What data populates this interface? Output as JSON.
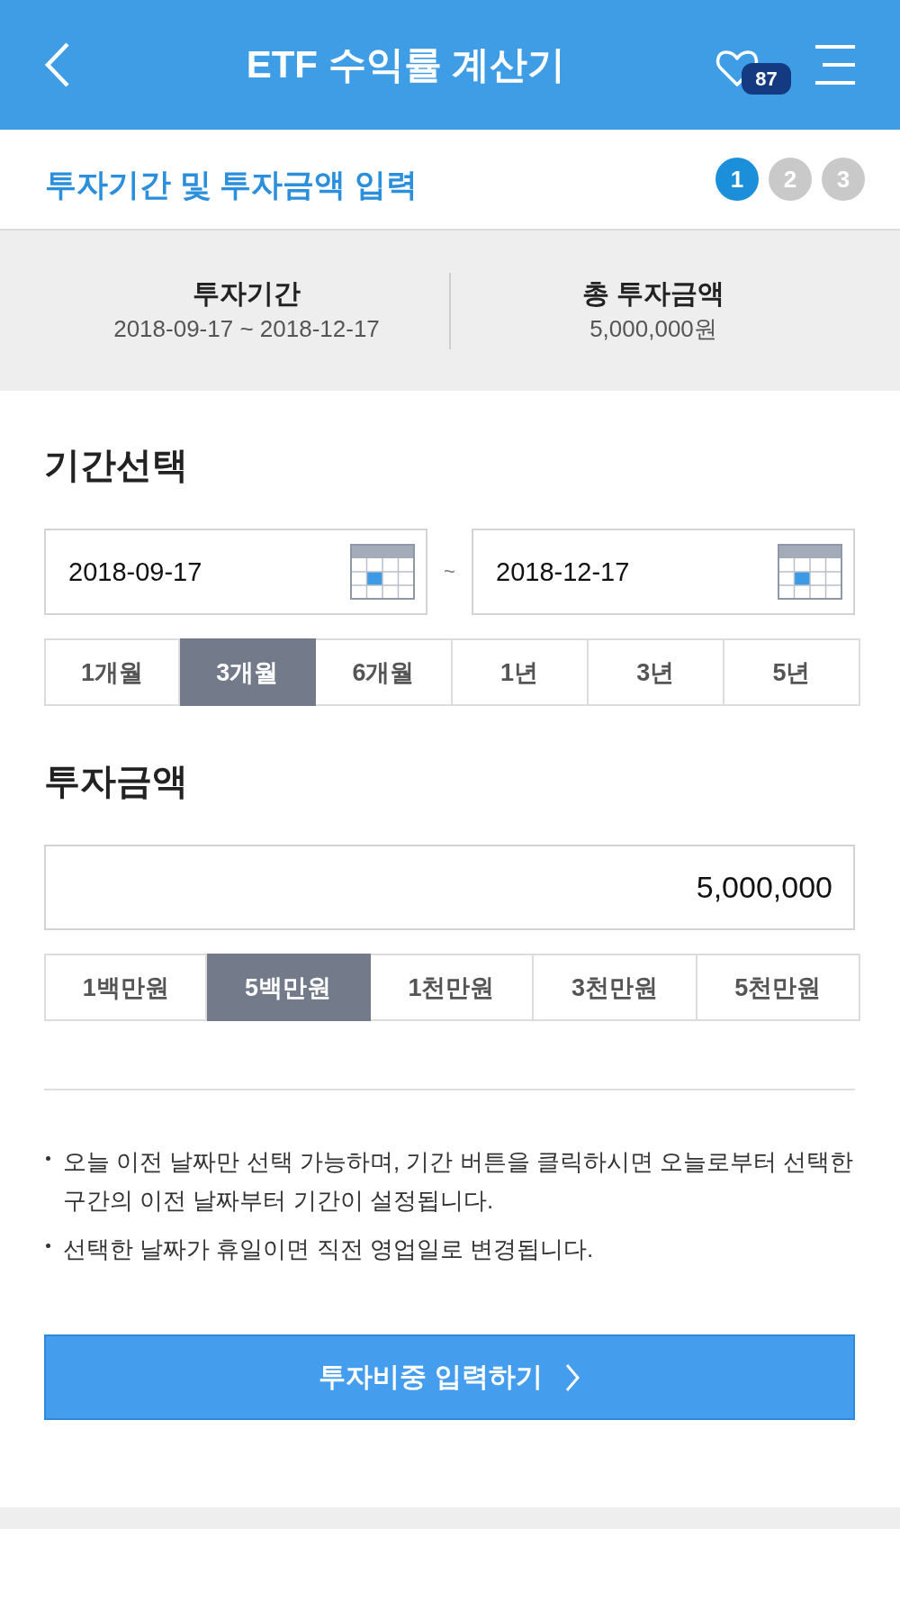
{
  "header": {
    "title": "ETF 수익률 계산기",
    "favorites_count": "87"
  },
  "step": {
    "title": "투자기간 및 투자금액 입력",
    "steps": [
      {
        "label": "1",
        "selected": true
      },
      {
        "label": "2",
        "selected": false
      },
      {
        "label": "3",
        "selected": false
      }
    ]
  },
  "summary": [
    {
      "label": "투자기간",
      "value": "2018-09-17 ~ 2018-12-17"
    },
    {
      "label": "총 투자금액",
      "value": "5,000,000원"
    }
  ],
  "period": {
    "heading": "기간선택",
    "start_date": "2018-09-17",
    "separator": "~",
    "end_date": "2018-12-17",
    "options": [
      {
        "label": "1개월",
        "selected": false
      },
      {
        "label": "3개월",
        "selected": true
      },
      {
        "label": "6개월",
        "selected": false
      },
      {
        "label": "1년",
        "selected": false
      },
      {
        "label": "3년",
        "selected": false
      },
      {
        "label": "5년",
        "selected": false
      }
    ]
  },
  "amount": {
    "heading": "투자금액",
    "value": "5,000,000",
    "options": [
      {
        "label": "1백만원",
        "selected": false
      },
      {
        "label": "5백만원",
        "selected": true
      },
      {
        "label": "1천만원",
        "selected": false
      },
      {
        "label": "3천만원",
        "selected": false
      },
      {
        "label": "5천만원",
        "selected": false
      }
    ]
  },
  "notes": [
    "오늘 이전 날짜만 선택 가능하며, 기간 버튼을 클릭하시면 오늘로부터 선택한 구간의 이전 날짜부터 기간이 설정됩니다.",
    "선택한 날짜가 휴일이면 직전 영업일로 변경됩니다."
  ],
  "next_button": {
    "label": "투자비중 입력하기"
  }
}
